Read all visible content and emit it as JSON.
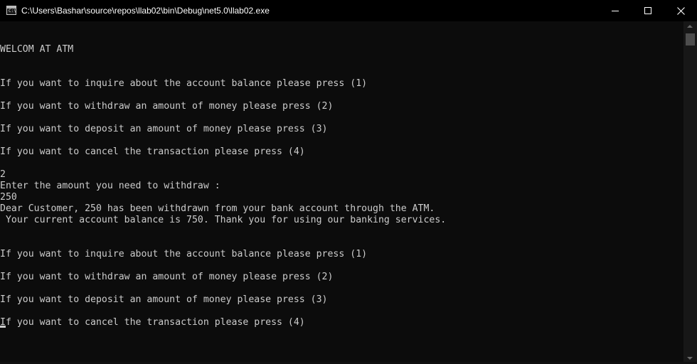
{
  "window": {
    "title": "C:\\Users\\Bashar\\source\\repos\\llab02\\bin\\Debug\\net5.0\\llab02.exe",
    "icon": "console-app-icon",
    "icon_text": "C:\\",
    "controls": [
      "minimize-icon",
      "maximize-icon",
      "close-icon"
    ]
  },
  "console": {
    "background": "#0c0c0c",
    "foreground": "#cccccc",
    "lines": [
      "WELCOM AT ATM",
      "",
      "",
      "If you want to inquire about the account balance please press (1)",
      "",
      "If you want to withdraw an amount of money please press (2)",
      "",
      "If you want to deposit an amount of money please press (3)",
      "",
      "If you want to cancel the transaction please press (4)",
      "",
      "2",
      "Enter the amount you need to withdraw :",
      "250",
      "Dear Customer, 250 has been withdrawn from your bank account through the ATM.",
      " Your current account balance is 750. Thank you for using our banking services.",
      "",
      "",
      "If you want to inquire about the account balance please press (1)",
      "",
      "If you want to withdraw an amount of money please press (2)",
      "",
      "If you want to deposit an amount of money please press (3)",
      "",
      "If you want to cancel the transaction please press (4)"
    ]
  }
}
